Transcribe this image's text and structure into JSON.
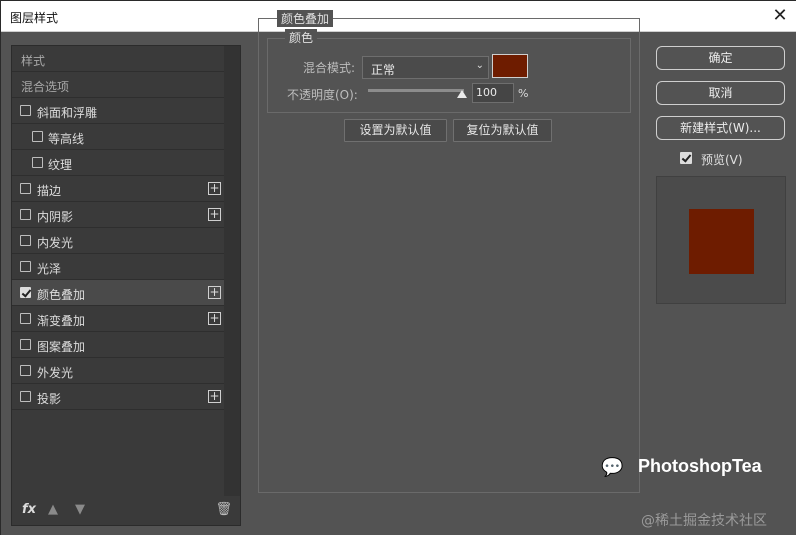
{
  "window": {
    "title": "图层样式"
  },
  "effects": [
    {
      "label": "样式",
      "header": true
    },
    {
      "label": "混合选项",
      "header": true
    },
    {
      "label": "斜面和浮雕",
      "checked": false
    },
    {
      "label": "等高线",
      "checked": false,
      "sub": true
    },
    {
      "label": "纹理",
      "checked": false,
      "sub": true
    },
    {
      "label": "描边",
      "checked": false,
      "plus": true
    },
    {
      "label": "内阴影",
      "checked": false,
      "plus": true
    },
    {
      "label": "内发光",
      "checked": false
    },
    {
      "label": "光泽",
      "checked": false
    },
    {
      "label": "颜色叠加",
      "checked": true,
      "plus": true,
      "selected": true
    },
    {
      "label": "渐变叠加",
      "checked": false,
      "plus": true
    },
    {
      "label": "图案叠加",
      "checked": false
    },
    {
      "label": "外发光",
      "checked": false
    },
    {
      "label": "投影",
      "checked": false,
      "plus": true
    }
  ],
  "footer": {
    "fx": "fx",
    "up": "▲",
    "down": "▼",
    "trash": "🗑"
  },
  "panel": {
    "title": "颜色叠加",
    "group_title": "颜色",
    "blend_label": "混合模式:",
    "blend_value": "正常",
    "overlay_color": "#6e1c00",
    "opacity_label": "不透明度(O):",
    "opacity_value": "100",
    "opacity_unit": "%",
    "opacity_fraction": 1.0,
    "default_btn": "设置为默认值",
    "reset_btn": "复位为默认值"
  },
  "right": {
    "ok": "确定",
    "cancel": "取消",
    "new_style": "新建样式(W)...",
    "preview_label": "预览(V)",
    "preview_checked": true
  },
  "watermark": {
    "brand": "PhotoshopTea",
    "sub": "@稀土掘金技术社区"
  }
}
